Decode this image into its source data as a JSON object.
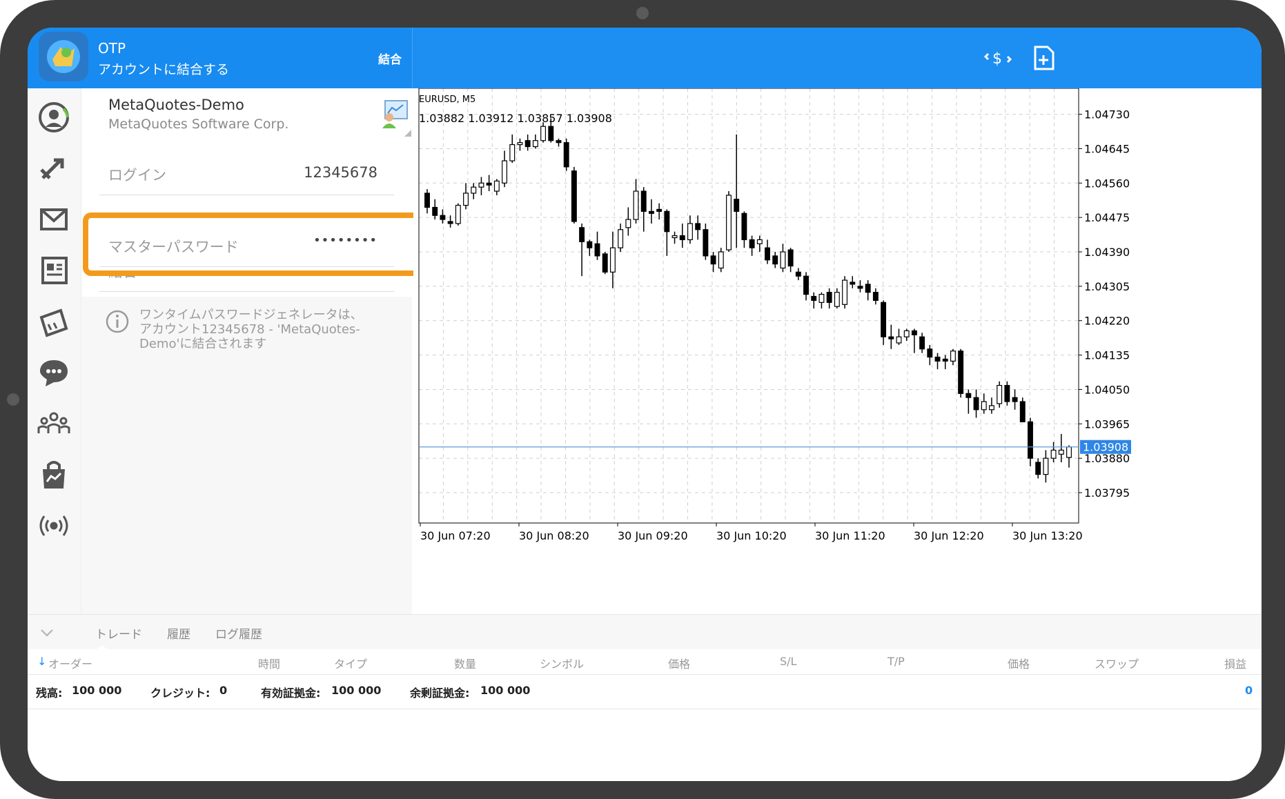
{
  "header": {
    "title": "OTP",
    "subtitle": "アカウントに結合する",
    "action_label": "結合",
    "icons": [
      "currency-exchange-icon",
      "new-document-icon"
    ],
    "colors": {
      "primary": "#1d8ef2",
      "highlight": "#f39a1e"
    }
  },
  "account": {
    "server": "MetaQuotes-Demo",
    "company": "MetaQuotes Software Corp."
  },
  "form": {
    "login_label": "ログイン",
    "login_value": "12345678",
    "password_label": "マスターパスワード",
    "password_value": "••••••••",
    "bind_label": "結合",
    "bind_checked": true
  },
  "info": {
    "text": "ワンタイムパスワードジェネレータは、アカウント12345678 - 'MetaQuotes-Demo'に結合されます"
  },
  "sidebar": {
    "icons": [
      "account-icon",
      "trade-icon",
      "mail-icon",
      "news-icon",
      "calendar-icon",
      "chat-icon",
      "community-icon",
      "market-icon",
      "signal-icon"
    ]
  },
  "chart_data": {
    "type": "candlestick",
    "symbol_label": "EURUSD, M5",
    "ohlc_label": "1.03882 1.03912 1.03857 1.03908",
    "current_price": "1.03908",
    "y_ticks": [
      "1.04730",
      "1.04645",
      "1.04560",
      "1.04475",
      "1.04390",
      "1.04305",
      "1.04220",
      "1.04135",
      "1.04050",
      "1.03965",
      "1.03880",
      "1.03795"
    ],
    "x_ticks": [
      "30 Jun 07:20",
      "30 Jun 08:20",
      "30 Jun 09:20",
      "30 Jun 10:20",
      "30 Jun 11:20",
      "30 Jun 12:20",
      "30 Jun 13:20"
    ],
    "ylim": [
      1.0372,
      1.0476
    ],
    "candles": [
      [
        1.04535,
        1.04545,
        1.04485,
        1.045
      ],
      [
        1.045,
        1.0452,
        1.0447,
        1.0448
      ],
      [
        1.0448,
        1.04495,
        1.0446,
        1.0447
      ],
      [
        1.04465,
        1.0448,
        1.0445,
        1.0446
      ],
      [
        1.0446,
        1.0451,
        1.04455,
        1.04505
      ],
      [
        1.04505,
        1.0456,
        1.04495,
        1.04535
      ],
      [
        1.04535,
        1.0456,
        1.0452,
        1.0455
      ],
      [
        1.0455,
        1.04575,
        1.0453,
        1.0456
      ],
      [
        1.0456,
        1.0458,
        1.0454,
        1.04555
      ],
      [
        1.0454,
        1.0457,
        1.0453,
        1.04565
      ],
      [
        1.0456,
        1.0464,
        1.0455,
        1.04615
      ],
      [
        1.04615,
        1.0468,
        1.0461,
        1.04655
      ],
      [
        1.04655,
        1.0467,
        1.0464,
        1.0466
      ],
      [
        1.04665,
        1.0468,
        1.0464,
        1.0465
      ],
      [
        1.0465,
        1.0468,
        1.04645,
        1.04665
      ],
      [
        1.04665,
        1.0471,
        1.0466,
        1.047
      ],
      [
        1.047,
        1.0472,
        1.0466,
        1.04665
      ],
      [
        1.04665,
        1.0467,
        1.0465,
        1.0466
      ],
      [
        1.0466,
        1.0467,
        1.0459,
        1.046
      ],
      [
        1.0459,
        1.046,
        1.0446,
        1.04465
      ],
      [
        1.0445,
        1.0446,
        1.0433,
        1.04415
      ],
      [
        1.04415,
        1.0442,
        1.0438,
        1.044
      ],
      [
        1.0441,
        1.0444,
        1.0437,
        1.0438
      ],
      [
        1.04385,
        1.0439,
        1.04335,
        1.0434
      ],
      [
        1.0434,
        1.0444,
        1.043,
        1.044
      ],
      [
        1.044,
        1.0446,
        1.0439,
        1.04445
      ],
      [
        1.0445,
        1.045,
        1.0443,
        1.0447
      ],
      [
        1.0447,
        1.0457,
        1.0446,
        1.0454
      ],
      [
        1.0454,
        1.0455,
        1.0444,
        1.0449
      ],
      [
        1.0449,
        1.0452,
        1.0446,
        1.04485
      ],
      [
        1.04495,
        1.0451,
        1.0447,
        1.0449
      ],
      [
        1.0449,
        1.04495,
        1.0438,
        1.0444
      ],
      [
        1.04425,
        1.0444,
        1.0441,
        1.0443
      ],
      [
        1.0443,
        1.0446,
        1.044,
        1.0442
      ],
      [
        1.0442,
        1.0448,
        1.0441,
        1.0446
      ],
      [
        1.0446,
        1.0448,
        1.0442,
        1.04445
      ],
      [
        1.04445,
        1.0446,
        1.0437,
        1.0438
      ],
      [
        1.0438,
        1.0439,
        1.0434,
        1.0436
      ],
      [
        1.0435,
        1.044,
        1.0434,
        1.0439
      ],
      [
        1.04395,
        1.0454,
        1.0439,
        1.0453
      ],
      [
        1.0452,
        1.0468,
        1.044,
        1.0449
      ],
      [
        1.04485,
        1.0449,
        1.044,
        1.0442
      ],
      [
        1.0442,
        1.0443,
        1.0438,
        1.044
      ],
      [
        1.0441,
        1.0443,
        1.0439,
        1.0442
      ],
      [
        1.044,
        1.0442,
        1.0436,
        1.0437
      ],
      [
        1.0438,
        1.0439,
        1.0435,
        1.0436
      ],
      [
        1.0435,
        1.0441,
        1.0434,
        1.0439
      ],
      [
        1.04395,
        1.044,
        1.0434,
        1.04355
      ],
      [
        1.0434,
        1.0435,
        1.0432,
        1.0433
      ],
      [
        1.0433,
        1.0434,
        1.0427,
        1.04285
      ],
      [
        1.0428,
        1.0429,
        1.0425,
        1.0427
      ],
      [
        1.04265,
        1.0429,
        1.0425,
        1.04285
      ],
      [
        1.0429,
        1.043,
        1.0425,
        1.04265
      ],
      [
        1.04255,
        1.043,
        1.0425,
        1.0429
      ],
      [
        1.0426,
        1.0433,
        1.0425,
        1.0432
      ],
      [
        1.04315,
        1.0433,
        1.043,
        1.0431
      ],
      [
        1.04305,
        1.0432,
        1.0429,
        1.043
      ],
      [
        1.0431,
        1.0432,
        1.0427,
        1.0429
      ],
      [
        1.0429,
        1.043,
        1.0426,
        1.0427
      ],
      [
        1.04265,
        1.0427,
        1.0416,
        1.0418
      ],
      [
        1.0418,
        1.0421,
        1.0415,
        1.04175
      ],
      [
        1.04165,
        1.042,
        1.0416,
        1.0418
      ],
      [
        1.0418,
        1.042,
        1.0417,
        1.04195
      ],
      [
        1.04195,
        1.042,
        1.0414,
        1.04185
      ],
      [
        1.0418,
        1.0419,
        1.0414,
        1.0415
      ],
      [
        1.0415,
        1.0416,
        1.0411,
        1.0413
      ],
      [
        1.0413,
        1.0414,
        1.041,
        1.0412
      ],
      [
        1.04125,
        1.04135,
        1.041,
        1.0412
      ],
      [
        1.0412,
        1.0415,
        1.0411,
        1.04145
      ],
      [
        1.04145,
        1.0415,
        1.0403,
        1.0404
      ],
      [
        1.0404,
        1.0405,
        1.0399,
        1.0403
      ],
      [
        1.0403,
        1.0405,
        1.0398,
        1.04
      ],
      [
        1.04,
        1.0404,
        1.0399,
        1.0402
      ],
      [
        1.04,
        1.0403,
        1.0399,
        1.0401
      ],
      [
        1.04015,
        1.0407,
        1.04005,
        1.0406
      ],
      [
        1.0406,
        1.0407,
        1.0401,
        1.0402
      ],
      [
        1.0403,
        1.0405,
        1.04,
        1.0402
      ],
      [
        1.0402,
        1.0403,
        1.0397,
        1.0397
      ],
      [
        1.0397,
        1.0398,
        1.0386,
        1.0388
      ],
      [
        1.0387,
        1.0388,
        1.0383,
        1.0384
      ],
      [
        1.0384,
        1.039,
        1.0382,
        1.0388
      ],
      [
        1.0388,
        1.0392,
        1.0387,
        1.039
      ],
      [
        1.0389,
        1.0394,
        1.0387,
        1.039
      ],
      [
        1.03882,
        1.03912,
        1.03857,
        1.03908
      ]
    ],
    "colors": {
      "current_line": "#5b9bd5",
      "label_bg": "#2e86e6"
    }
  },
  "bottom": {
    "tabs": [
      "トレード",
      "履歴",
      "ログ履歴"
    ],
    "columns": [
      "オーダー",
      "時間",
      "タイプ",
      "数量",
      "シンボル",
      "価格",
      "S/L",
      "T/P",
      "価格",
      "スワップ",
      "損益"
    ],
    "balance_label": "残高:",
    "balance_value": "100 000",
    "credit_label": "クレジット:",
    "credit_value": "0",
    "equity_label": "有効証拠金:",
    "equity_value": "100 000",
    "free_margin_label": "余剰証拠金:",
    "free_margin_value": "100 000",
    "profit_value": "0"
  }
}
